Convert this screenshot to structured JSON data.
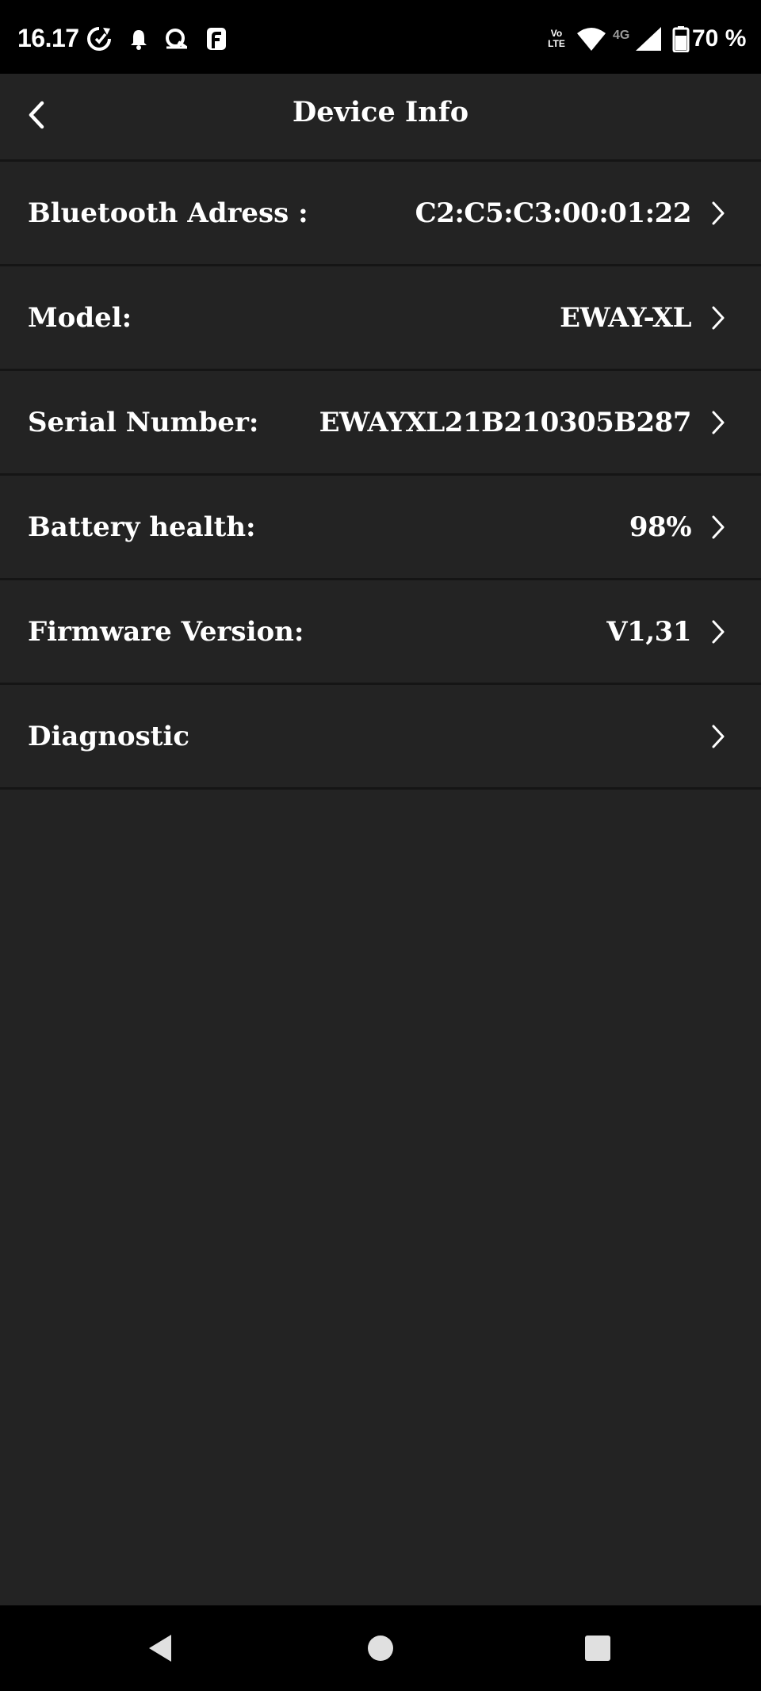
{
  "status_bar": {
    "time": "16.17",
    "volte_top": "Vo",
    "volte_bottom": "LTE",
    "network": "4G",
    "battery": "70 %",
    "icons": [
      "sync-icon",
      "bell-icon",
      "search-app-icon",
      "app-f-icon",
      "wifi-icon",
      "signal-icon",
      "battery-icon"
    ]
  },
  "header": {
    "title": "Device Info",
    "back_icon": "chevron-left-icon"
  },
  "rows": [
    {
      "label": "Bluetooth Adress :",
      "value": "C2:C5:C3:00:01:22"
    },
    {
      "label": "Model:",
      "value": "EWAY-XL"
    },
    {
      "label": "Serial Number:",
      "value": "EWAYXL21B210305B287"
    },
    {
      "label": "Battery health:",
      "value": "98%"
    },
    {
      "label": "Firmware Version:",
      "value": "V1,31"
    },
    {
      "label": "Diagnostic",
      "value": ""
    }
  ],
  "nav_bar": {
    "icons": [
      "back-triangle-icon",
      "home-circle-icon",
      "recents-square-icon"
    ]
  },
  "colors": {
    "background": "#232323",
    "divider": "#151515",
    "text": "#ffffff",
    "system_bar": "#000000"
  }
}
